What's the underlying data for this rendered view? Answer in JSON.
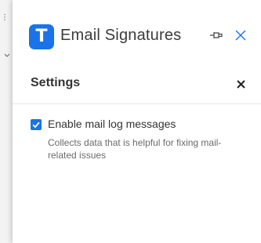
{
  "background": {
    "menu_glyph": "⋮"
  },
  "pane": {
    "logo_letter": "T",
    "title": "Email Signatures",
    "pin_icon": "pin-icon",
    "close_icon": "close-icon",
    "accent": "#1a73e8"
  },
  "settings": {
    "title": "Settings",
    "close_icon": "close-icon",
    "options": [
      {
        "label": "Enable mail log messages",
        "description": "Collects data that is helpful for fixing mail-related issues",
        "checked": true
      }
    ]
  }
}
